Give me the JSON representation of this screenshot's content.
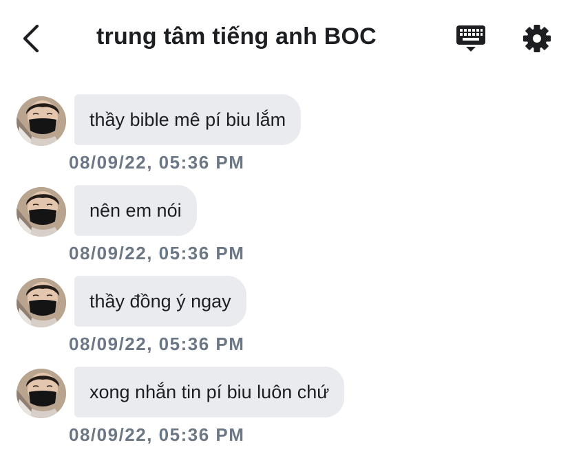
{
  "header": {
    "title": "trung tâm tiếng anh BOC",
    "back_icon": "chevron-left-icon",
    "keyboard_icon": "keyboard-icon",
    "settings_icon": "gear-icon"
  },
  "messages": [
    {
      "text": "thầy bible mê pí biu lắm",
      "timestamp": "08/09/22, 05:36 PM"
    },
    {
      "text": "nên em nói",
      "timestamp": "08/09/22, 05:36 PM"
    },
    {
      "text": "thầy đồng ý ngay",
      "timestamp": "08/09/22, 05:36 PM"
    },
    {
      "text": "xong nhắn tin pí biu luôn chứ",
      "timestamp": "08/09/22, 05:36 PM"
    }
  ],
  "colors": {
    "bubble": "#e9ebee",
    "timestamp": "#6b7785",
    "text": "#1c1e21"
  }
}
